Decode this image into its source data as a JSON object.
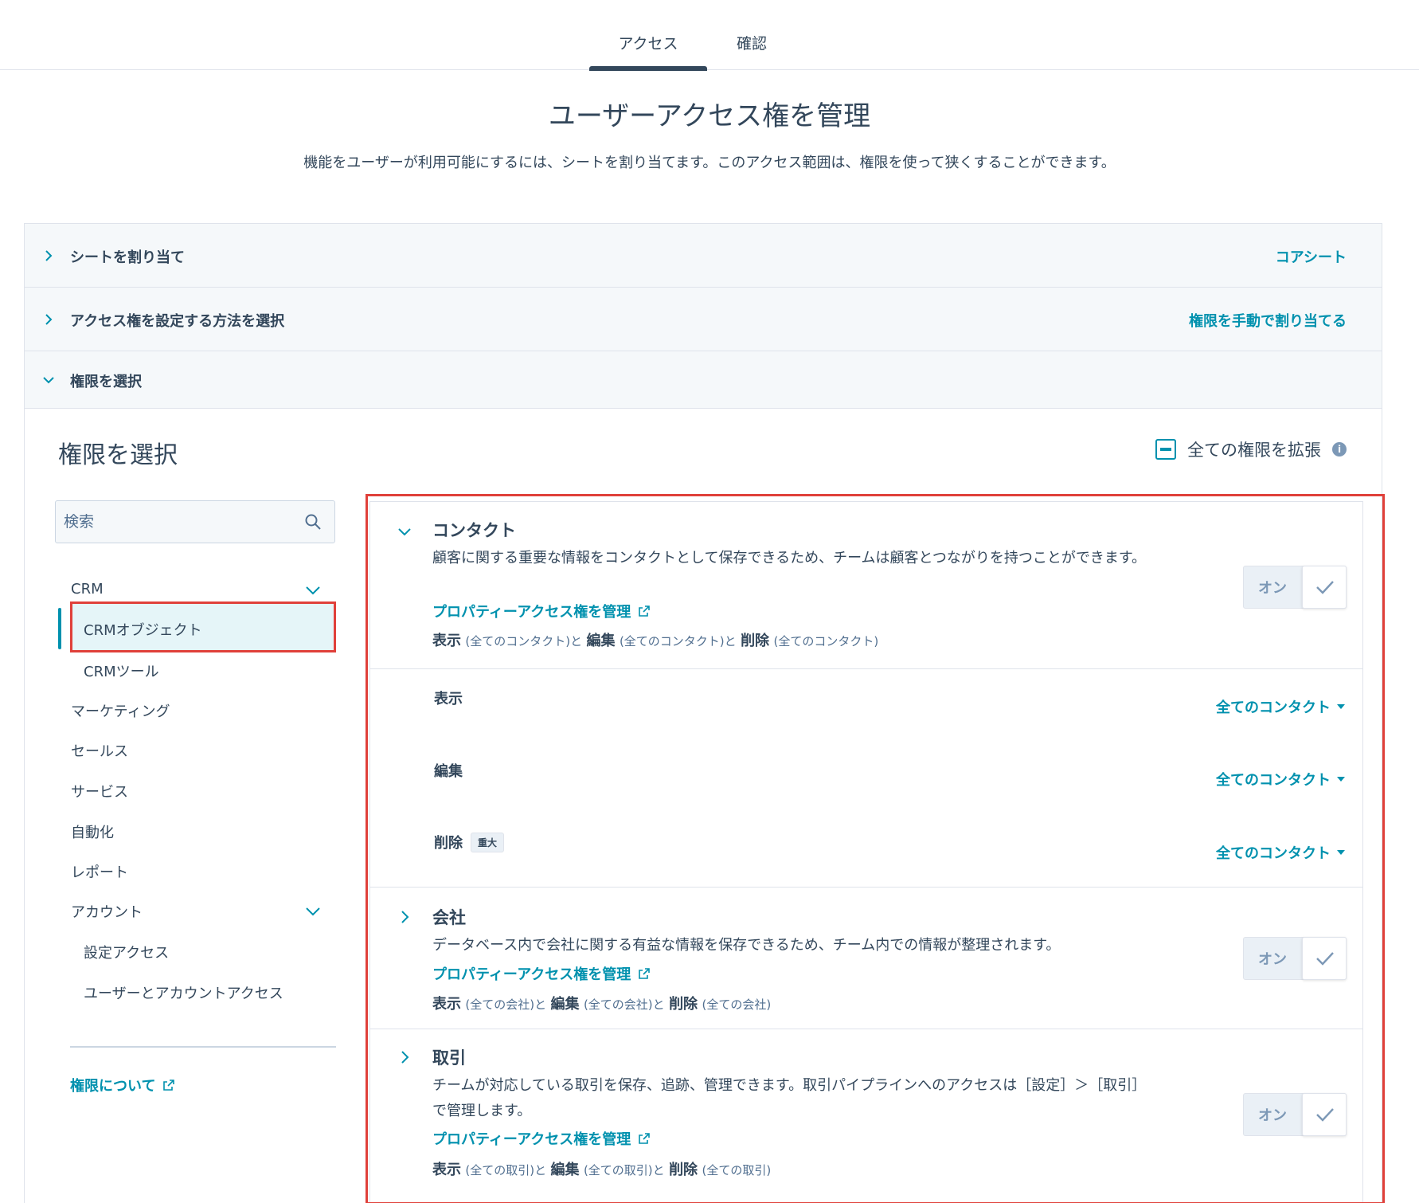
{
  "tabs": {
    "access": "アクセス",
    "confirm": "確認"
  },
  "page": {
    "title": "ユーザーアクセス権を管理",
    "description": "機能をユーザーが利用可能にするには、シートを割り当てます。このアクセス範囲は、権限を使って狭くすることができます。"
  },
  "accordion": [
    {
      "label": "シートを割り当て",
      "value": "コアシート"
    },
    {
      "label": "アクセス権を設定する方法を選択",
      "value": "権限を手動で割り当てる"
    },
    {
      "label": "権限を選択",
      "value": ""
    }
  ],
  "permissions": {
    "heading": "権限を選択",
    "expand_all": "全ての権限を拡張"
  },
  "sidebar": {
    "search_placeholder": "検索",
    "items": [
      "CRM",
      "CRMオブジェクト",
      "CRMツール",
      "マーケティング",
      "セールス",
      "サービス",
      "自動化",
      "レポート",
      "アカウント",
      "設定アクセス",
      "ユーザーとアカウントアクセス"
    ],
    "about_link": "権限について"
  },
  "sections": [
    {
      "title": "コンタクト",
      "description": "顧客に関する重要な情報をコンタクトとして保存できるため、チームは顧客とつながりを持つことができます。",
      "link": "プロパティーアクセス権を管理",
      "summary": {
        "view": "表示",
        "view_scope": "(全てのコンタクト)と",
        "edit": "編集",
        "edit_scope": "(全てのコンタクト)と",
        "delete": "削除",
        "delete_scope": "(全てのコンタクト)"
      },
      "toggle": "オン",
      "rows": [
        {
          "label": "表示",
          "value": "全てのコンタクト",
          "badge": ""
        },
        {
          "label": "編集",
          "value": "全てのコンタクト",
          "badge": ""
        },
        {
          "label": "削除",
          "value": "全てのコンタクト",
          "badge": "重大"
        }
      ]
    },
    {
      "title": "会社",
      "description": "データベース内で会社に関する有益な情報を保存できるため、チーム内での情報が整理されます。",
      "link": "プロパティーアクセス権を管理",
      "summary": {
        "view": "表示",
        "view_scope": "(全ての会社)と",
        "edit": "編集",
        "edit_scope": "(全ての会社)と",
        "delete": "削除",
        "delete_scope": "(全ての会社)"
      },
      "toggle": "オン"
    },
    {
      "title": "取引",
      "description": "チームが対応している取引を保存、追跡、管理できます。取引パイプラインへのアクセスは［設定］＞［取引］で管理します。",
      "link": "プロパティーアクセス権を管理",
      "summary": {
        "view": "表示",
        "view_scope": "(全ての取引)と",
        "edit": "編集",
        "edit_scope": "(全ての取引)と",
        "delete": "削除",
        "delete_scope": "(全ての取引)"
      },
      "toggle": "オン"
    }
  ],
  "colors": {
    "accent": "#0091ae",
    "text": "#33475b",
    "highlight_box": "#e0403a",
    "panel_bg": "#f5f8fa"
  }
}
